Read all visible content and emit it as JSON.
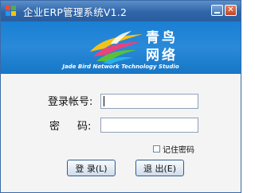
{
  "window": {
    "title": "企业ERP管理系统V1.2"
  },
  "banner": {
    "brand_cn_line1": "青鸟",
    "brand_cn_line2": "网络",
    "brand_en": "Jade Bird Network Technology Studio"
  },
  "form": {
    "account_label": "登录帐号:",
    "password_label_1": "密",
    "password_label_2": "码:",
    "account_value": "",
    "password_value": "",
    "remember_label": "记住密码",
    "remember_checked": false
  },
  "buttons": {
    "login_label": "登 录(L)",
    "exit_label": "退 出(E)"
  },
  "colors": {
    "titlebar": "#2f65a8",
    "banner": "#1a7fd3",
    "accent_yellow": "#f2c21c",
    "accent_green": "#5bbf3a"
  }
}
